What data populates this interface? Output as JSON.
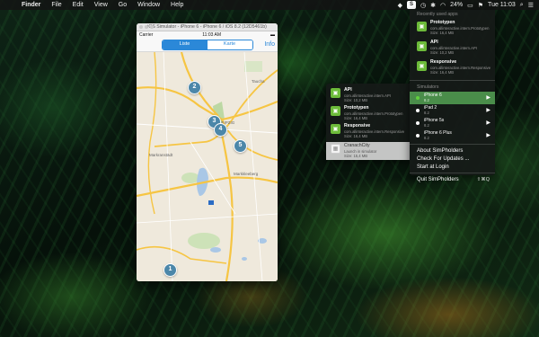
{
  "menubar": {
    "apple": "",
    "items": [
      "Finder",
      "File",
      "Edit",
      "View",
      "Go",
      "Window",
      "Help"
    ],
    "battery": "24%",
    "clock": "Tue 11:03"
  },
  "simulator": {
    "title": "iOS Simulator - iPhone 6 - iPhone 6 / iOS 8.2 (12D5461b)",
    "status_carrier": "Carrier",
    "status_time": "11:03 AM",
    "segments": [
      "Liste",
      "Karte"
    ],
    "active_segment": "Liste",
    "info_label": "Info",
    "map_labels": [
      "Markranstädt",
      "Markkleeberg",
      "Taucha",
      "LEIPZIG"
    ],
    "pins": [
      "2",
      "3",
      "4",
      "5",
      "1"
    ]
  },
  "dropdown": {
    "recent_header": "Recently used apps",
    "recent_apps": [
      {
        "name": "Prototypen",
        "bundle": "com.allinteractive.intern.Prototypen",
        "size": "Size: 16,4 MB"
      },
      {
        "name": "API",
        "bundle": "com.allinteractive.intern.API",
        "size": "Size: 10,2 MB"
      },
      {
        "name": "Responsive",
        "bundle": "com.allinteractive.intern.Responsive",
        "size": "Size: 16,4 MB"
      }
    ],
    "sim_header": "Simulators",
    "simulators": [
      {
        "name": "iPhone 6",
        "version": "8.2",
        "selected": true
      },
      {
        "name": "iPad 2",
        "version": "8.2",
        "selected": false
      },
      {
        "name": "iPhone 5s",
        "version": "8.2",
        "selected": false
      },
      {
        "name": "iPhone 6 Plus",
        "version": "8.2",
        "selected": false
      }
    ],
    "about": "About SimPholders",
    "updates": "Check For Updates ...",
    "login": "Start at Login",
    "quit": "Quit SimPholders",
    "quit_shortcut": "⇧⌘Q"
  },
  "submenu": {
    "apps": [
      {
        "name": "API",
        "bundle": "com.allinteractive.intern.API",
        "size": "Size: 10,2 MB"
      },
      {
        "name": "Prototypen",
        "bundle": "com.allinteractive.intern.Prototypen",
        "size": "Size: 16,4 MB"
      },
      {
        "name": "Responsive",
        "bundle": "com.allinteractive.intern.Responsive",
        "size": "Size: 16,4 MB"
      }
    ],
    "cranach": {
      "name": "CranachCity",
      "bundle": "Launch in simulator",
      "size": "Size: 15,4 MB"
    }
  },
  "colors": {
    "accent": "#2b88d8",
    "pin": "#4c87a9",
    "selected_sim": "#4a8d4a",
    "app_icon": "#6dbb3a"
  }
}
